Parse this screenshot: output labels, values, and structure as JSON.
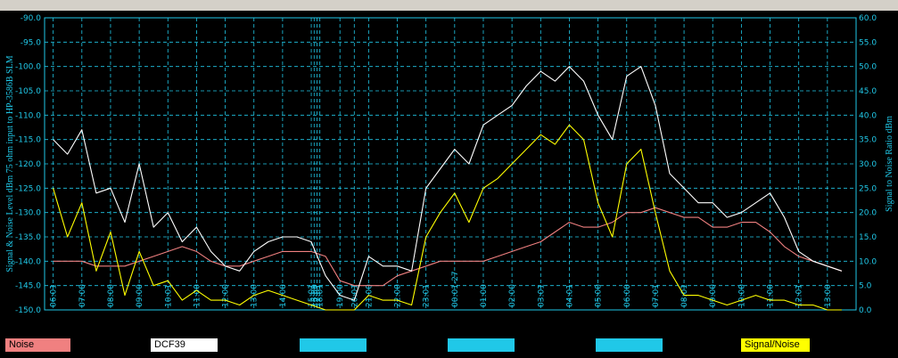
{
  "chart_data": {
    "type": "line",
    "ylabel": "Signal & Noise Level dBm 75 ohm input to HP-3586B SLM",
    "ylabel_right": "Signal to Noise Ratio dBm",
    "ylim": [
      -150,
      -90
    ],
    "ylim_right": [
      0,
      60
    ],
    "grid": true,
    "y_ticks": [
      "-90.0",
      "-95.0",
      "-100.0",
      "-105.0",
      "-110.0",
      "-115.0",
      "-120.0",
      "-125.0",
      "-130.0",
      "-135.0",
      "-140.0",
      "-145.0",
      "-150.0"
    ],
    "y_ticks_right": [
      "60.0",
      "55.0",
      "50.0",
      "45.0",
      "40.0",
      "35.0",
      "30.0",
      "25.0",
      "20.0",
      "15.0",
      "10.0",
      "5.0",
      "0.0"
    ],
    "x_tick_labels": [
      "06:01",
      "07:00",
      "08:00",
      "09:00",
      "10:01",
      "11:00",
      "12:00",
      "13:00",
      "14:00",
      "15:01",
      "16:00",
      "17:01",
      "18:01",
      "19:00",
      "20:01",
      "21:00",
      "22:00",
      "23:01",
      "00:01-27",
      "01:00",
      "02:00",
      "03:01",
      "04:01",
      "05:00",
      "06:00",
      "07:01",
      "08:01",
      "09:00",
      "10:00",
      "11:00",
      "12:01",
      "13:00"
    ],
    "x_tick_positions": [
      0,
      1,
      2,
      3,
      4,
      5,
      6,
      7,
      8,
      9,
      9.1,
      9.2,
      9.3,
      10,
      10.5,
      11,
      12,
      13,
      14,
      15,
      16,
      17,
      18,
      19,
      20,
      21,
      22,
      23,
      24,
      25,
      26,
      27
    ],
    "x_range": [
      -0.3,
      28
    ],
    "series": [
      {
        "name": "Noise",
        "axis": "left",
        "color": "#f08080",
        "x": [
          0,
          0.5,
          1,
          1.5,
          2,
          2.5,
          3,
          3.5,
          4,
          4.5,
          5,
          5.5,
          6,
          6.5,
          7,
          7.5,
          8,
          8.5,
          9,
          9.5,
          10,
          10.5,
          11,
          11.5,
          12,
          12.5,
          13,
          13.5,
          14,
          14.5,
          15,
          15.5,
          16,
          16.5,
          17,
          17.5,
          18,
          18.5,
          19,
          19.5,
          20,
          20.5,
          21,
          21.5,
          22,
          22.5,
          23,
          23.5,
          24,
          24.5,
          25,
          25.5,
          26,
          26.5,
          27,
          27.5
        ],
        "y": [
          -140,
          -140,
          -140,
          -141,
          -141,
          -141,
          -140,
          -139,
          -138,
          -137,
          -138,
          -140,
          -141,
          -141,
          -140,
          -139,
          -138,
          -138,
          -138,
          -139,
          -144,
          -145,
          -145,
          -145,
          -143,
          -142,
          -141,
          -140,
          -140,
          -140,
          -140,
          -139,
          -138,
          -137,
          -136,
          -134,
          -132,
          -133,
          -133,
          -132,
          -130,
          -130,
          -129,
          -130,
          -131,
          -131,
          -133,
          -133,
          -132,
          -132,
          -134,
          -137,
          -139,
          -140,
          -141,
          -142
        ]
      },
      {
        "name": "DCF39",
        "axis": "left",
        "color": "#ffffff",
        "x": [
          0,
          0.5,
          1,
          1.5,
          2,
          2.5,
          3,
          3.5,
          4,
          4.5,
          5,
          5.5,
          6,
          6.5,
          7,
          7.5,
          8,
          8.5,
          9,
          9.5,
          10,
          10.5,
          11,
          11.5,
          12,
          12.5,
          13,
          13.5,
          14,
          14.5,
          15,
          15.5,
          16,
          16.5,
          17,
          17.5,
          18,
          18.5,
          19,
          19.5,
          20,
          20.5,
          21,
          21.5,
          22,
          22.5,
          23,
          23.5,
          24,
          24.5,
          25,
          25.5,
          26,
          26.5,
          27,
          27.5
        ],
        "y": [
          -115,
          -118,
          -113,
          -126,
          -125,
          -132,
          -120,
          -133,
          -130,
          -136,
          -133,
          -138,
          -141,
          -142,
          -138,
          -136,
          -135,
          -135,
          -136,
          -143,
          -147,
          -148,
          -139,
          -141,
          -141,
          -142,
          -125,
          -121,
          -117,
          -120,
          -112,
          -110,
          -108,
          -104,
          -101,
          -103,
          -100,
          -103,
          -110,
          -115,
          -102,
          -100,
          -108,
          -122,
          -125,
          -128,
          -128,
          -131,
          -130,
          -128,
          -126,
          -131,
          -138,
          -140,
          -141,
          -142
        ]
      },
      {
        "name": "Signal/Noise",
        "axis": "right",
        "color": "#ffff00",
        "x": [
          0,
          0.5,
          1,
          1.5,
          2,
          2.5,
          3,
          3.5,
          4,
          4.5,
          5,
          5.5,
          6,
          6.5,
          7,
          7.5,
          8,
          8.5,
          9,
          9.5,
          10,
          10.5,
          11,
          11.5,
          12,
          12.5,
          13,
          13.5,
          14,
          14.5,
          15,
          15.5,
          16,
          16.5,
          17,
          17.5,
          18,
          18.5,
          19,
          19.5,
          20,
          20.5,
          21,
          21.5,
          22,
          22.5,
          23,
          23.5,
          24,
          24.5,
          25,
          25.5,
          26,
          26.5,
          27,
          27.5
        ],
        "y": [
          25,
          15,
          22,
          8,
          16,
          3,
          12,
          5,
          6,
          2,
          4,
          2,
          2,
          1,
          3,
          4,
          3,
          2,
          1,
          0,
          0,
          0,
          3,
          2,
          2,
          1,
          15,
          20,
          24,
          18,
          25,
          27,
          30,
          33,
          36,
          34,
          38,
          35,
          22,
          15,
          30,
          33,
          20,
          8,
          3,
          3,
          2,
          1,
          2,
          3,
          2,
          2,
          1,
          1,
          0,
          0
        ]
      }
    ]
  },
  "legend": [
    {
      "label": "Noise",
      "color": "#f08080"
    },
    {
      "label": "DCF39",
      "color": "#ffffff"
    },
    {
      "label": "",
      "color": "#20c8e8"
    },
    {
      "label": "",
      "color": "#20c8e8"
    },
    {
      "label": "",
      "color": "#20c8e8"
    },
    {
      "label": "Signal/Noise",
      "color": "#ffff00"
    }
  ]
}
